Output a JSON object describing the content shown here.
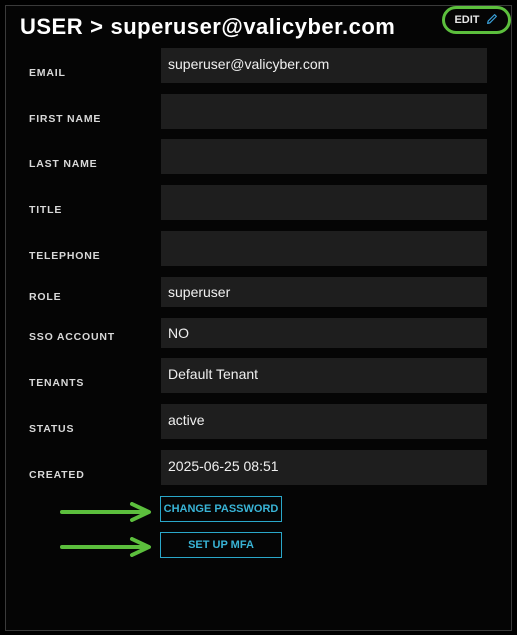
{
  "header": {
    "section": "USER",
    "separator": ">",
    "username": "superuser@valicyber.com",
    "edit_label": "EDIT",
    "edit_icon": "pencil-icon",
    "highlight_color": "#5cbf3d"
  },
  "fields": {
    "email": {
      "label": "EMAIL",
      "value": "superuser@valicyber.com"
    },
    "first_name": {
      "label": "FIRST NAME",
      "value": ""
    },
    "last_name": {
      "label": "LAST NAME",
      "value": ""
    },
    "title": {
      "label": "TITLE",
      "value": ""
    },
    "telephone": {
      "label": "TELEPHONE",
      "value": ""
    },
    "role": {
      "label": "ROLE",
      "value": "superuser"
    },
    "sso_account": {
      "label": "SSO ACCOUNT",
      "value": "NO"
    },
    "tenants": {
      "label": "TENANTS",
      "value": "Default Tenant"
    },
    "status": {
      "label": "STATUS",
      "value": "active"
    },
    "created": {
      "label": "CREATED",
      "value": "2025-06-25 08:51"
    }
  },
  "actions": {
    "change_password_label": "CHANGE PASSWORD",
    "setup_mfa_label": "SET UP MFA",
    "accent_color": "#2aa7c9",
    "annotation_arrow_color": "#5cbf3d"
  }
}
